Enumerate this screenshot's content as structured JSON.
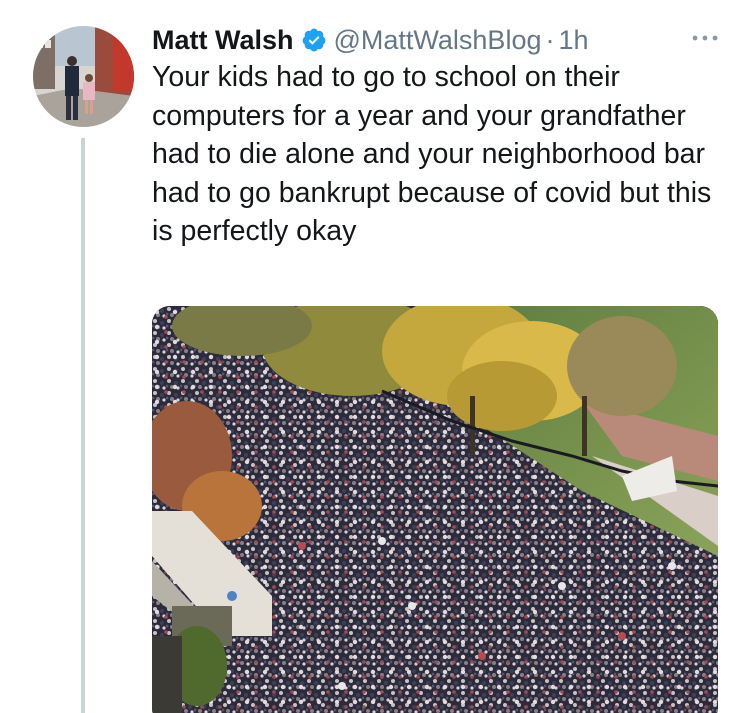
{
  "tweet": {
    "author_name": "Matt Walsh",
    "handle": "@MattWalshBlog",
    "separator": "·",
    "time": "1h",
    "text": "Your kids had to go to school on their computers for a year and your grandfather had to die alone and your neighborhood bar had to go bankrupt because of covid but this is perfectly okay",
    "verified": true
  },
  "icons": {
    "verified": "verified-badge-icon",
    "more": "more-options-icon"
  },
  "colors": {
    "name": "#14171a",
    "secondary": "#657786",
    "verified": "#1da1f2",
    "thread_line": "#c9d3db"
  }
}
